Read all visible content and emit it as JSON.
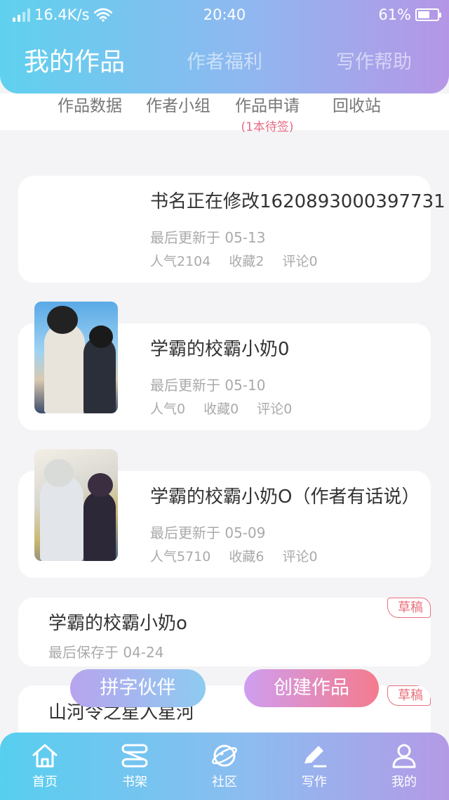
{
  "status_bar": {
    "speed": "16.4K/s",
    "time": "20:40",
    "battery": "61%",
    "battery_level": 0.61
  },
  "tabs": [
    {
      "label": "我的作品",
      "active": true
    },
    {
      "label": "作者福利",
      "active": false
    },
    {
      "label": "写作帮助",
      "active": false
    }
  ],
  "subnav": {
    "items": [
      {
        "label": "作品数据"
      },
      {
        "label": "作者小组"
      },
      {
        "label": "作品申请",
        "note": "(1本待签)"
      },
      {
        "label": "回收站"
      }
    ]
  },
  "works": [
    {
      "title": "书名正在修改1620893000397731",
      "updated": "最后更新于 05-13",
      "popularity": "人气2104",
      "favorites": "收藏2",
      "comments": "评论0"
    },
    {
      "title": "学霸的校霸小奶0",
      "updated": "最后更新于 05-10",
      "popularity": "人气0",
      "favorites": "收藏0",
      "comments": "评论0"
    },
    {
      "title": "学霸的校霸小奶O（作者有话说）",
      "updated": "最后更新于 05-09",
      "popularity": "人气5710",
      "favorites": "收藏6",
      "comments": "评论0"
    }
  ],
  "drafts": [
    {
      "title": "学霸的校霸小奶o",
      "saved": "最后保存于 04-24",
      "badge": "草稿"
    },
    {
      "title": "山河令之星入星河",
      "badge": "草稿"
    }
  ],
  "actions": {
    "partner": "拼字伙伴",
    "create": "创建作品"
  },
  "bottom_nav": [
    {
      "label": "首页",
      "icon": "home-icon"
    },
    {
      "label": "书架",
      "icon": "bookshelf-icon"
    },
    {
      "label": "社区",
      "icon": "planet-icon"
    },
    {
      "label": "写作",
      "icon": "pen-icon",
      "active": true
    },
    {
      "label": "我的",
      "icon": "user-icon"
    }
  ],
  "colors": {
    "gradient_start": "#5fd1ee",
    "gradient_end": "#b596e6",
    "accent_red": "#e8707c"
  }
}
